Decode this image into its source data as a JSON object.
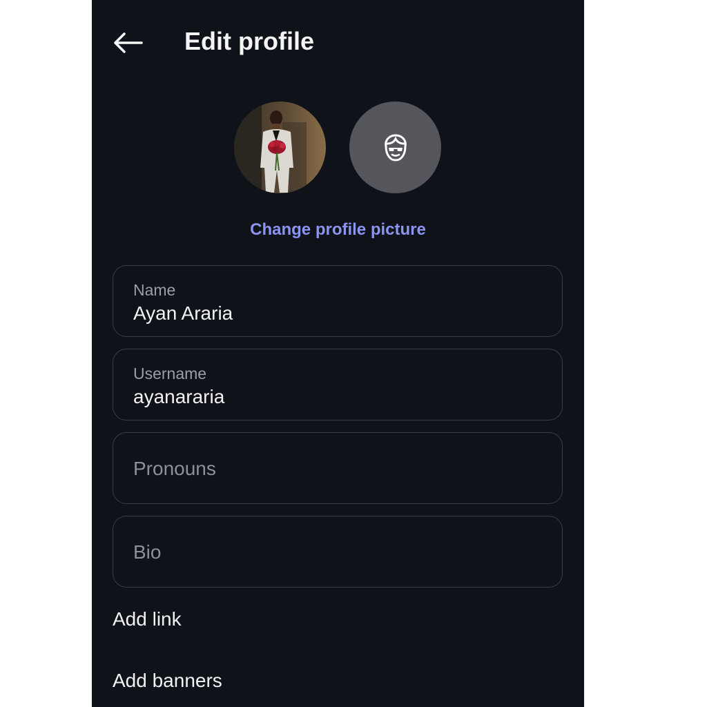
{
  "header": {
    "title": "Edit profile",
    "back_icon": "arrow-left-icon"
  },
  "profile_picture": {
    "change_label": "Change profile picture",
    "avatar_icon": "avatar-face-icon"
  },
  "fields": {
    "name": {
      "label": "Name",
      "value": "Ayan Araria"
    },
    "username": {
      "label": "Username",
      "value": "ayanararia"
    },
    "pronouns": {
      "placeholder": "Pronouns"
    },
    "bio": {
      "placeholder": "Bio"
    }
  },
  "links": {
    "add_link": "Add link",
    "add_banners": "Add banners"
  },
  "colors": {
    "background": "#10121a",
    "accent": "#8a95f2",
    "field_border": "#3a3c44",
    "avatar_bg": "#55565c"
  }
}
